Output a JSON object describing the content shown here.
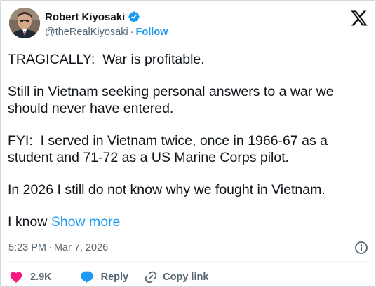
{
  "author": {
    "display_name": "Robert Kiyosaki",
    "handle": "@theRealKiyosaki",
    "separator": "·",
    "follow_label": "Follow"
  },
  "tweet": {
    "paragraphs": [
      "TRAGICALLY:  War is profitable.",
      "Still in Vietnam seeking personal answers to a war we should never have entered.",
      "FYI:  I served in Vietnam twice, once in 1966-67 as a student and 71-72 as a US Marine Corps pilot.",
      "In 2026 I still do not know why we fought in Vietnam."
    ],
    "truncated_text": "I know ",
    "show_more_label": "Show more"
  },
  "meta": {
    "time": "5:23 PM",
    "separator": "·",
    "date": "Mar 7, 2026"
  },
  "actions": {
    "like_count": "2.9K",
    "reply_label": "Reply",
    "copy_link_label": "Copy link"
  },
  "colors": {
    "accent": "#1d9bf0",
    "like": "#f91880",
    "secondary_text": "#536471"
  },
  "icons": [
    "verified-badge-icon",
    "x-logo-icon",
    "info-icon",
    "heart-icon",
    "reply-icon",
    "link-icon"
  ]
}
